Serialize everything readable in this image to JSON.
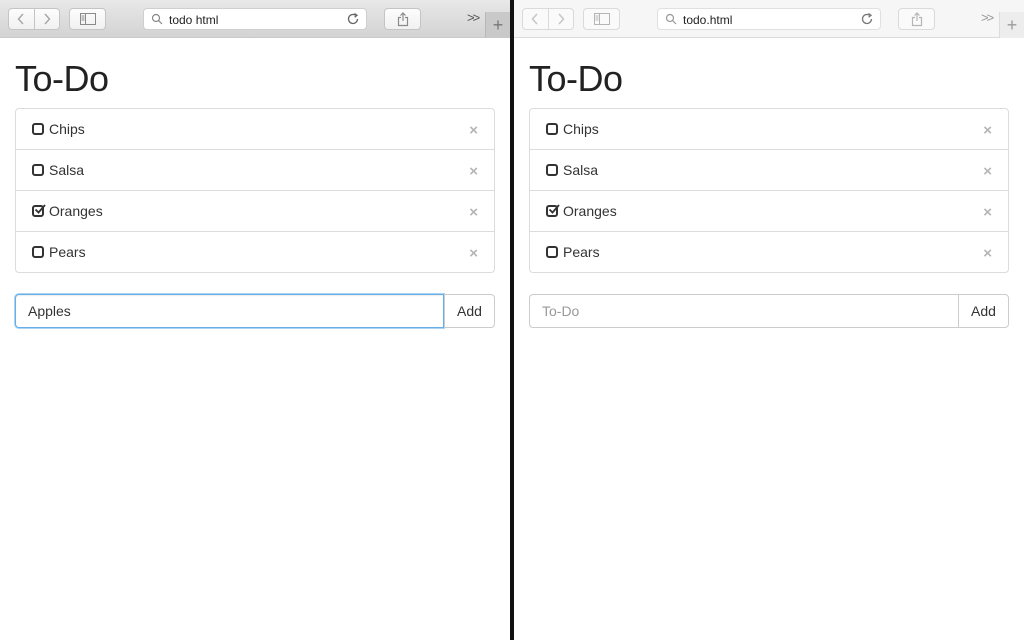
{
  "windows": [
    {
      "address_url": "todo html",
      "page_title": "To-Do",
      "items": [
        {
          "label": "Chips",
          "checked": false
        },
        {
          "label": "Salsa",
          "checked": false
        },
        {
          "label": "Oranges",
          "checked": true
        },
        {
          "label": "Pears",
          "checked": false
        }
      ],
      "remove_glyph": "×",
      "input_value": "Apples",
      "input_placeholder": "To-Do",
      "add_label": "Add",
      "focused": true
    },
    {
      "address_url": "todo.html",
      "page_title": "To-Do",
      "items": [
        {
          "label": "Chips",
          "checked": false
        },
        {
          "label": "Salsa",
          "checked": false
        },
        {
          "label": "Oranges",
          "checked": true
        },
        {
          "label": "Pears",
          "checked": false
        }
      ],
      "remove_glyph": "×",
      "input_value": "",
      "input_placeholder": "To-Do",
      "add_label": "Add",
      "focused": false
    }
  ],
  "toolbar": {
    "overflow_glyph": ">>",
    "new_tab_glyph": "+"
  },
  "icons": {
    "back": "chevron-left-icon",
    "forward": "chevron-right-icon",
    "sidebar": "sidebar-icon",
    "search": "magnifier-icon",
    "reload": "reload-icon",
    "share": "share-icon",
    "checkbox": "checkbox-icon",
    "remove": "close-icon"
  },
  "colors": {
    "focus_ring": "#66afe9",
    "divider": "#111111"
  }
}
